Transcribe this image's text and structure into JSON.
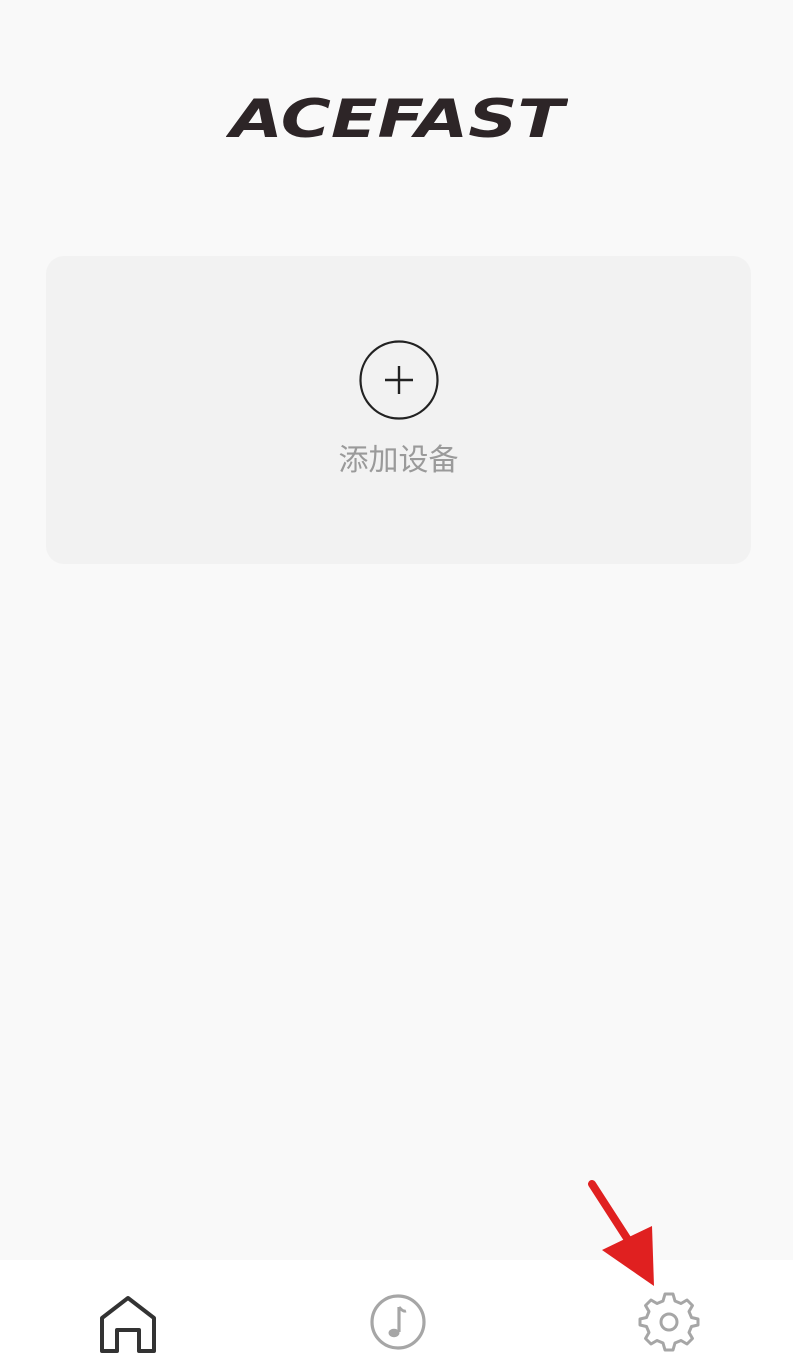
{
  "app": {
    "logo_text": "ACEFAST"
  },
  "add_device": {
    "label": "添加设备",
    "icon": "plus-circle-icon"
  },
  "tab_bar": {
    "tabs": [
      {
        "id": "home",
        "icon": "home-icon",
        "selected": true
      },
      {
        "id": "music",
        "icon": "music-note-icon",
        "selected": false
      },
      {
        "id": "settings",
        "icon": "gear-icon",
        "selected": false
      }
    ]
  },
  "annotation": {
    "icon": "red-arrow-icon",
    "color": "#e02020",
    "points_to": "settings"
  },
  "colors": {
    "background": "#f9f9f9",
    "card": "#f2f2f2",
    "logo": "#2d2527",
    "muted_text": "#9a9a9a",
    "icon_active": "#333333",
    "icon_inactive": "#a6a6a6"
  }
}
